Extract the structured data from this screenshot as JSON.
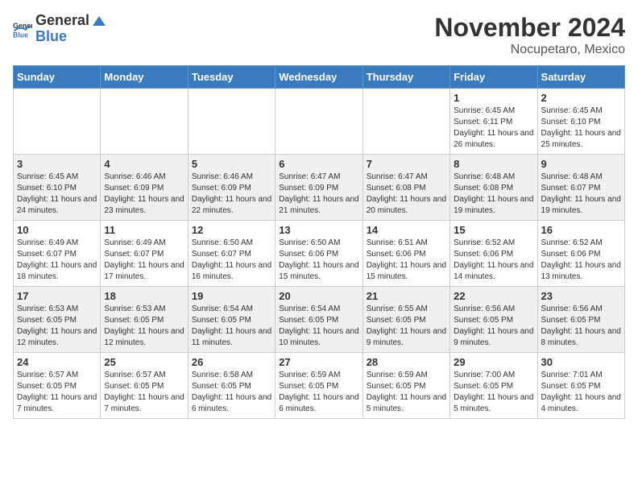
{
  "header": {
    "logo_general": "General",
    "logo_blue": "Blue",
    "month_title": "November 2024",
    "location": "Nocupetaro, Mexico"
  },
  "days_of_week": [
    "Sunday",
    "Monday",
    "Tuesday",
    "Wednesday",
    "Thursday",
    "Friday",
    "Saturday"
  ],
  "weeks": [
    [
      {
        "day": "",
        "info": ""
      },
      {
        "day": "",
        "info": ""
      },
      {
        "day": "",
        "info": ""
      },
      {
        "day": "",
        "info": ""
      },
      {
        "day": "",
        "info": ""
      },
      {
        "day": "1",
        "info": "Sunrise: 6:45 AM\nSunset: 6:11 PM\nDaylight: 11 hours and 26 minutes."
      },
      {
        "day": "2",
        "info": "Sunrise: 6:45 AM\nSunset: 6:10 PM\nDaylight: 11 hours and 25 minutes."
      }
    ],
    [
      {
        "day": "3",
        "info": "Sunrise: 6:45 AM\nSunset: 6:10 PM\nDaylight: 11 hours and 24 minutes."
      },
      {
        "day": "4",
        "info": "Sunrise: 6:46 AM\nSunset: 6:09 PM\nDaylight: 11 hours and 23 minutes."
      },
      {
        "day": "5",
        "info": "Sunrise: 6:46 AM\nSunset: 6:09 PM\nDaylight: 11 hours and 22 minutes."
      },
      {
        "day": "6",
        "info": "Sunrise: 6:47 AM\nSunset: 6:09 PM\nDaylight: 11 hours and 21 minutes."
      },
      {
        "day": "7",
        "info": "Sunrise: 6:47 AM\nSunset: 6:08 PM\nDaylight: 11 hours and 20 minutes."
      },
      {
        "day": "8",
        "info": "Sunrise: 6:48 AM\nSunset: 6:08 PM\nDaylight: 11 hours and 19 minutes."
      },
      {
        "day": "9",
        "info": "Sunrise: 6:48 AM\nSunset: 6:07 PM\nDaylight: 11 hours and 19 minutes."
      }
    ],
    [
      {
        "day": "10",
        "info": "Sunrise: 6:49 AM\nSunset: 6:07 PM\nDaylight: 11 hours and 18 minutes."
      },
      {
        "day": "11",
        "info": "Sunrise: 6:49 AM\nSunset: 6:07 PM\nDaylight: 11 hours and 17 minutes."
      },
      {
        "day": "12",
        "info": "Sunrise: 6:50 AM\nSunset: 6:07 PM\nDaylight: 11 hours and 16 minutes."
      },
      {
        "day": "13",
        "info": "Sunrise: 6:50 AM\nSunset: 6:06 PM\nDaylight: 11 hours and 15 minutes."
      },
      {
        "day": "14",
        "info": "Sunrise: 6:51 AM\nSunset: 6:06 PM\nDaylight: 11 hours and 15 minutes."
      },
      {
        "day": "15",
        "info": "Sunrise: 6:52 AM\nSunset: 6:06 PM\nDaylight: 11 hours and 14 minutes."
      },
      {
        "day": "16",
        "info": "Sunrise: 6:52 AM\nSunset: 6:06 PM\nDaylight: 11 hours and 13 minutes."
      }
    ],
    [
      {
        "day": "17",
        "info": "Sunrise: 6:53 AM\nSunset: 6:05 PM\nDaylight: 11 hours and 12 minutes."
      },
      {
        "day": "18",
        "info": "Sunrise: 6:53 AM\nSunset: 6:05 PM\nDaylight: 11 hours and 12 minutes."
      },
      {
        "day": "19",
        "info": "Sunrise: 6:54 AM\nSunset: 6:05 PM\nDaylight: 11 hours and 11 minutes."
      },
      {
        "day": "20",
        "info": "Sunrise: 6:54 AM\nSunset: 6:05 PM\nDaylight: 11 hours and 10 minutes."
      },
      {
        "day": "21",
        "info": "Sunrise: 6:55 AM\nSunset: 6:05 PM\nDaylight: 11 hours and 9 minutes."
      },
      {
        "day": "22",
        "info": "Sunrise: 6:56 AM\nSunset: 6:05 PM\nDaylight: 11 hours and 9 minutes."
      },
      {
        "day": "23",
        "info": "Sunrise: 6:56 AM\nSunset: 6:05 PM\nDaylight: 11 hours and 8 minutes."
      }
    ],
    [
      {
        "day": "24",
        "info": "Sunrise: 6:57 AM\nSunset: 6:05 PM\nDaylight: 11 hours and 7 minutes."
      },
      {
        "day": "25",
        "info": "Sunrise: 6:57 AM\nSunset: 6:05 PM\nDaylight: 11 hours and 7 minutes."
      },
      {
        "day": "26",
        "info": "Sunrise: 6:58 AM\nSunset: 6:05 PM\nDaylight: 11 hours and 6 minutes."
      },
      {
        "day": "27",
        "info": "Sunrise: 6:59 AM\nSunset: 6:05 PM\nDaylight: 11 hours and 6 minutes."
      },
      {
        "day": "28",
        "info": "Sunrise: 6:59 AM\nSunset: 6:05 PM\nDaylight: 11 hours and 5 minutes."
      },
      {
        "day": "29",
        "info": "Sunrise: 7:00 AM\nSunset: 6:05 PM\nDaylight: 11 hours and 5 minutes."
      },
      {
        "day": "30",
        "info": "Sunrise: 7:01 AM\nSunset: 6:05 PM\nDaylight: 11 hours and 4 minutes."
      }
    ]
  ]
}
